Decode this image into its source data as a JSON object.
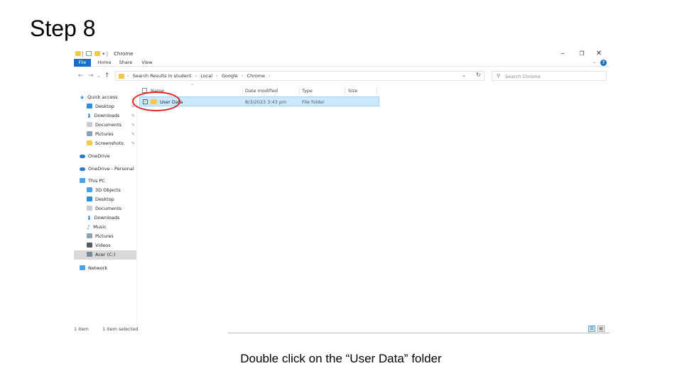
{
  "slide": {
    "title": "Step 8",
    "caption": "Double click on the “User Data” folder"
  },
  "window": {
    "title": "Chrome",
    "controls": {
      "minimize": "–",
      "restore": "❐",
      "close": "✕"
    }
  },
  "ribbon": {
    "tabs": [
      "File",
      "Home",
      "Share",
      "View"
    ],
    "help": "?",
    "expand": "⌄"
  },
  "address": {
    "breadcrumbs": [
      "Search Results in student",
      "Local",
      "Google",
      "Chrome"
    ],
    "separator": "›",
    "dropdown": "⌄",
    "refresh": "↻",
    "search_placeholder": "Search Chrome"
  },
  "nav_buttons": {
    "back": "←",
    "forward": "→",
    "recent": "⌄",
    "up": "↑"
  },
  "sidebar": {
    "quick_access": {
      "label": "Quick access",
      "items": [
        {
          "label": "Desktop",
          "icon": "desktop-icon",
          "color": "#2b8fe0"
        },
        {
          "label": "Downloads",
          "icon": "downloads-icon",
          "color": "#2b7bd6"
        },
        {
          "label": "Documents",
          "icon": "documents-icon",
          "color": "#c8ccd2"
        },
        {
          "label": "Pictures",
          "icon": "pictures-icon",
          "color": "#8aa0b4"
        },
        {
          "label": "Screenshots",
          "icon": "folder-icon",
          "color": "#f5c84b"
        }
      ],
      "pin": "📌"
    },
    "onedrive": "OneDrive",
    "onedrive_personal": "OneDrive - Personal",
    "this_pc": {
      "label": "This PC",
      "items": [
        {
          "label": "3D Objects",
          "icon": "3d-objects-icon",
          "color": "#4aa3e8"
        },
        {
          "label": "Desktop",
          "icon": "desktop-icon",
          "color": "#2b8fe0"
        },
        {
          "label": "Documents",
          "icon": "documents-icon",
          "color": "#c8ccd2"
        },
        {
          "label": "Downloads",
          "icon": "downloads-icon",
          "color": "#2b7bd6"
        },
        {
          "label": "Music",
          "icon": "music-icon",
          "color": "#3a8ee6"
        },
        {
          "label": "Pictures",
          "icon": "pictures-icon",
          "color": "#8aa0b4"
        },
        {
          "label": "Videos",
          "icon": "videos-icon",
          "color": "#555a60"
        },
        {
          "label": "Acer (C:)",
          "icon": "drive-icon",
          "color": "#7a8a99"
        }
      ]
    },
    "network": "Network"
  },
  "columns": [
    "Name",
    "Date modified",
    "Type",
    "Size"
  ],
  "files": [
    {
      "name": "User Data",
      "date_modified": "8/3/2023 3:43 pm",
      "type": "File folder",
      "size": ""
    }
  ],
  "status": {
    "item_count": "1 item",
    "selected": "1 item selected"
  },
  "colors": {
    "accent": "#1a6fc4",
    "selection": "#cce8ff",
    "highlight_ring": "#e02020",
    "folder": "#f5c84b"
  }
}
